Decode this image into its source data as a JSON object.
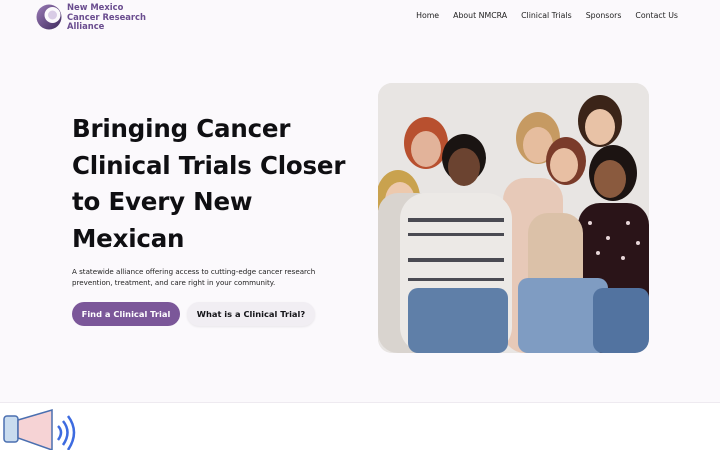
{
  "brand": {
    "line1": "New Mexico",
    "line2": "Cancer Research",
    "line3": "Alliance",
    "logo_icon": "crescent-logo-icon",
    "colors": {
      "primary": "#7b5799",
      "brand_text": "#6a4d8f"
    }
  },
  "nav": {
    "items": [
      {
        "label": "Home"
      },
      {
        "label": "About NMCRA"
      },
      {
        "label": "Clinical Trials"
      },
      {
        "label": "Sponsors"
      },
      {
        "label": "Contact Us"
      }
    ]
  },
  "hero": {
    "title": "Bringing Cancer Clinical Trials Closer to Every New Mexican",
    "subtitle": "A statewide alliance offering access to cutting-edge cancer research prevention, treatment, and care right in your community.",
    "primary_button": "Find a Clinical Trial",
    "secondary_button": "What is a Clinical Trial?"
  },
  "lower": {
    "icon": "megaphone-icon"
  }
}
